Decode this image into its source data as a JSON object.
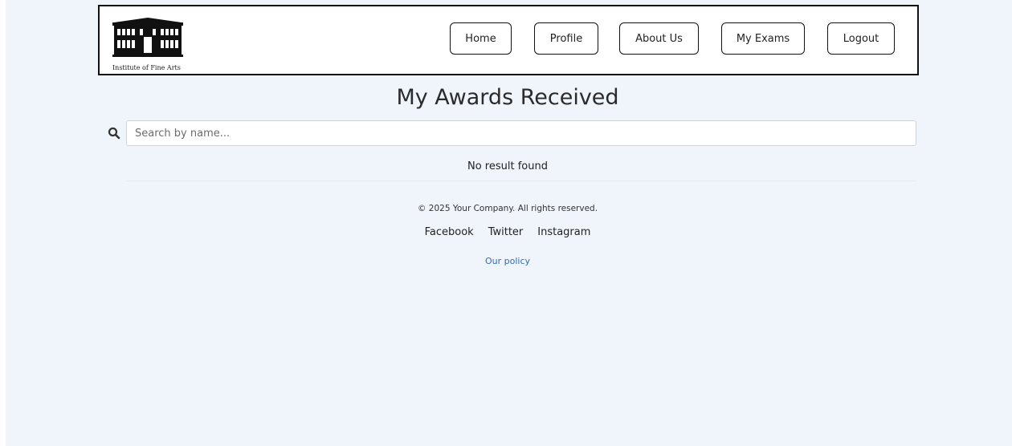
{
  "header": {
    "logo_caption": "Institute of Fine Arts",
    "nav": [
      {
        "label": "Home"
      },
      {
        "label": "Profile"
      },
      {
        "label": "About Us"
      },
      {
        "label": "My Exams"
      },
      {
        "label": "Logout"
      }
    ]
  },
  "main": {
    "title": "My Awards Received",
    "search": {
      "placeholder": "Search by name...",
      "value": "",
      "icon": "search-icon"
    },
    "empty_message": "No result found"
  },
  "footer": {
    "copyright": "© 2025 Your Company. All rights reserved.",
    "social": [
      {
        "label": "Facebook"
      },
      {
        "label": "Twitter"
      },
      {
        "label": "Instagram"
      }
    ],
    "policy_link": "Our policy"
  },
  "colors": {
    "page_background": "#f0f4fb",
    "link": "#2f6db5",
    "header_border": "#111111"
  }
}
